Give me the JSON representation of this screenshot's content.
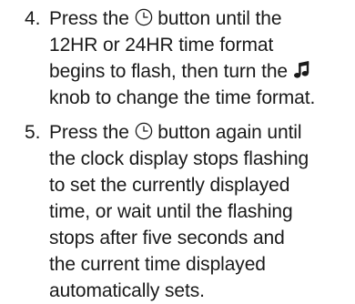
{
  "steps": [
    {
      "number": "4.",
      "line1_before": "Press the ",
      "line1_icon": "clock-icon",
      "line1_after": " button until the",
      "line2": "12HR or 24HR time format",
      "line3_before": "begins to flash, then turn the ",
      "line3_icon": "music-note-icon",
      "line4": "knob to change the time format."
    },
    {
      "number": "5.",
      "line1_before": "Press the ",
      "line1_icon": "clock-icon",
      "line1_after": " button again until",
      "lines": [
        "the clock display stops flashing",
        "to set the currently displayed",
        "time, or wait until the flashing",
        "stops after five seconds and",
        "the current time displayed",
        "automatically sets."
      ]
    }
  ]
}
